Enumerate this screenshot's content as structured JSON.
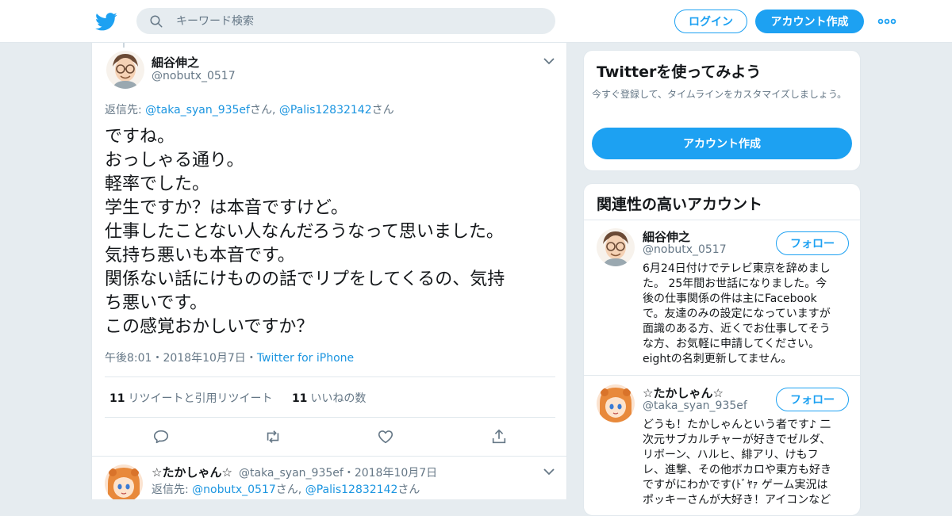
{
  "header": {
    "search_placeholder": "キーワード検索",
    "login_label": "ログイン",
    "signup_label": "アカウント作成",
    "brand_color": "#1da1f2"
  },
  "tweet": {
    "name": "細谷伸之",
    "handle": "@nobutx_0517",
    "reply_prefix": "返信先: ",
    "reply_user1": "@taka_syan_935ef",
    "reply_san1": "さん, ",
    "reply_user2": "@Palis12832142",
    "reply_san2": "さん",
    "lines": [
      "ですね。",
      "おっしゃる通り。",
      "軽率でした。",
      "学生ですか？は本音ですけど。",
      "仕事したことない人なんだろうなって思いました。",
      "気持ち悪いも本音です。",
      "関係ない話にけものの話でリプをしてくるの、気持",
      "ち悪いです。",
      "この感覚おかしいですか？"
    ],
    "time": "午後8:01",
    "sep": "・",
    "date": "2018年10月7日",
    "source": "Twitter for iPhone",
    "retweet_count": "11",
    "retweet_label": "リツイートと引用リツイート",
    "like_count": "11",
    "like_label": "いいねの数"
  },
  "reply": {
    "name": "☆たかしゃん☆",
    "handle": "@taka_syan_935ef",
    "sep": "・",
    "date": "2018年10月7日",
    "reply_prefix": "返信先: ",
    "reply_user1": "@nobutx_0517",
    "reply_san1": "さん, ",
    "reply_user2": "@Palis12832142",
    "reply_san2": "さん"
  },
  "sidebar": {
    "try_title": "Twitterを使ってみよう",
    "try_desc": "今すぐ登録して、タイムラインをカスタマイズしましょう。",
    "try_signup": "アカウント作成",
    "related_title": "関連性の高いアカウント",
    "accounts": [
      {
        "name": "細谷伸之",
        "handle": "@nobutx_0517",
        "follow": "フォロー",
        "bio": [
          "6月24日付けでテレビ東京を辞めまし",
          "た。 25年間お世話になりました。今",
          "後の仕事関係の件は主にFacebook",
          "で。友達のみの設定になっていますが",
          "面識のある方、近くでお仕事してそう",
          "な方、お気軽に申請してください。",
          "eightの名刺更新してません。"
        ]
      },
      {
        "name": "☆たかしゃん☆",
        "handle": "@taka_syan_935ef",
        "follow": "フォロー",
        "bio": [
          "どうも！たかしゃんという者です♪ 二",
          "次元サブカルチャーが好きでゼルダ、",
          "リボーン、ハルヒ、緋アリ、けもフ",
          "レ、進撃、その他ボカロや東方も好き",
          "ですがにわかです(ﾄﾞﾔｧ ゲーム実況は",
          "ポッキーさんが大好き！アイコンなど"
        ]
      }
    ]
  }
}
